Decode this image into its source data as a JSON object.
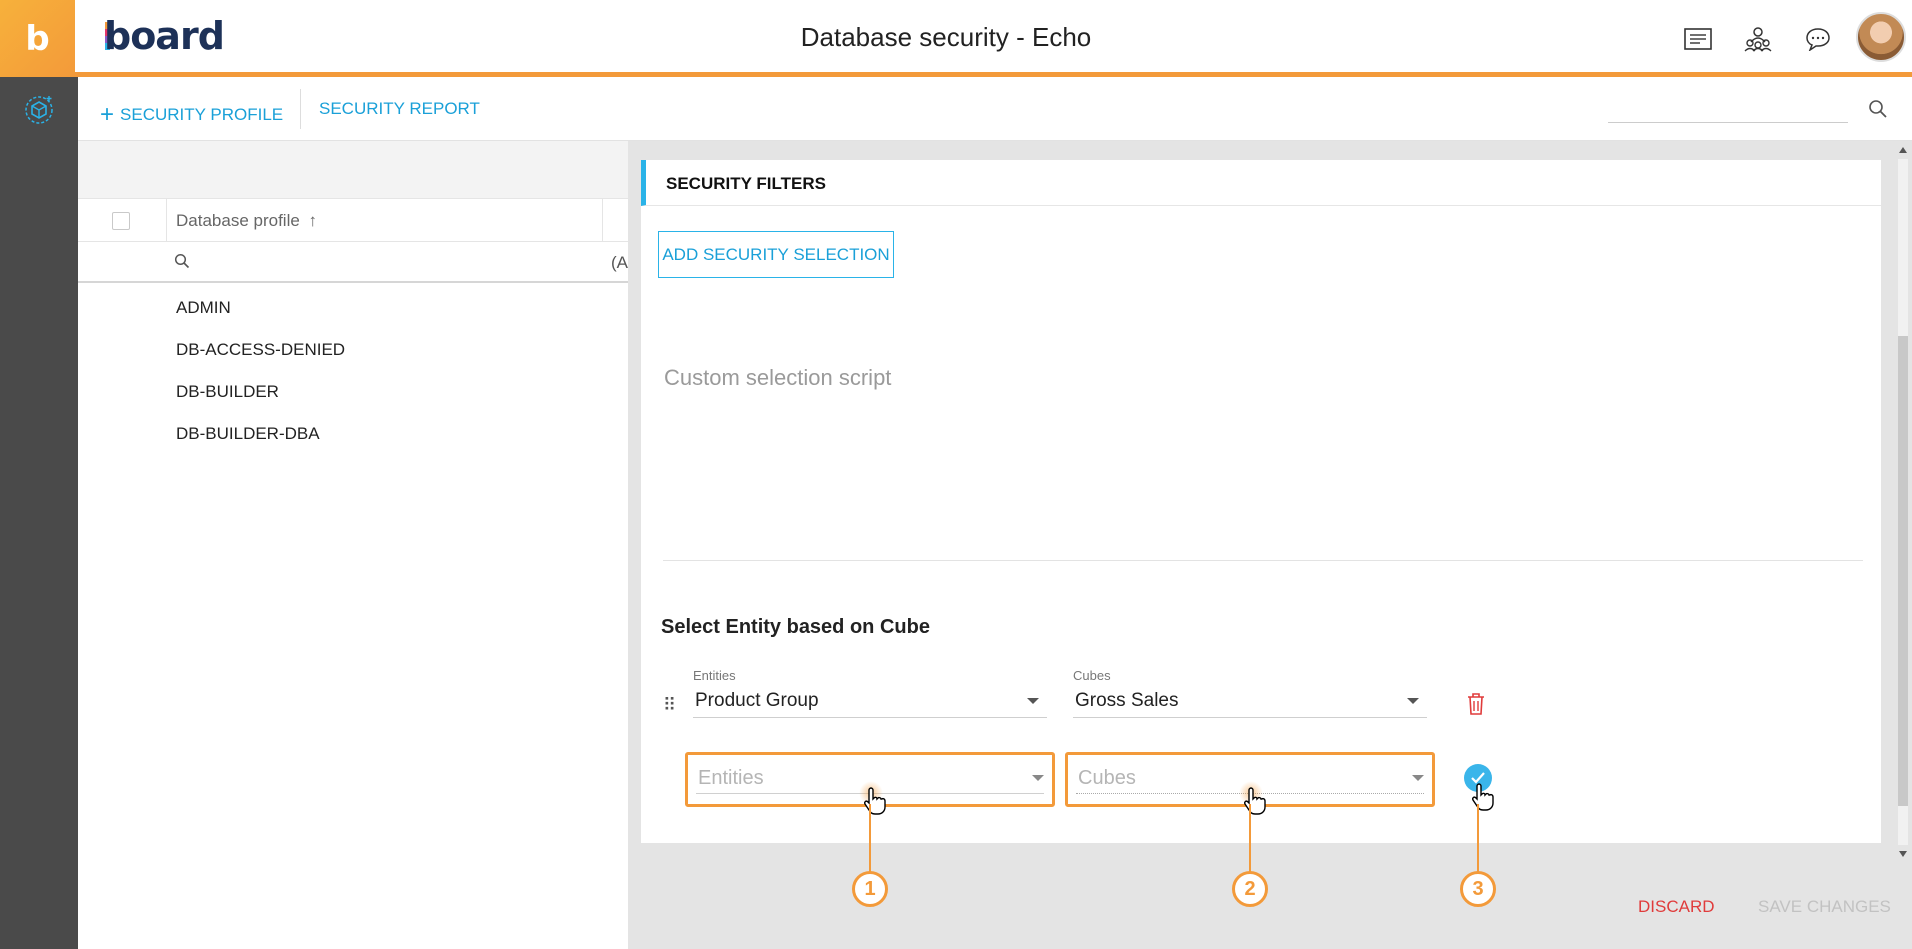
{
  "app": {
    "logo_letter": "b",
    "brand": "board",
    "title": "Database security - Echo"
  },
  "header_icons": [
    "presentation-icon",
    "collaboration-icon",
    "chat-icon",
    "user-avatar"
  ],
  "toolbar": {
    "add_profile_label": "SECURITY PROFILE",
    "report_label": "SECURITY REPORT",
    "search_placeholder": ""
  },
  "grid": {
    "column_header": "Database profile",
    "sort_indicator": "↑",
    "filter_fragment": "(A",
    "rows": [
      "ADMIN",
      "DB-ACCESS-DENIED",
      "DB-BUILDER",
      "DB-BUILDER-DBA"
    ]
  },
  "panel": {
    "section_title": "SECURITY FILTERS",
    "add_selection_label": "ADD SECURITY SELECTION",
    "script_placeholder": "Custom selection script",
    "subsection_title": "Select Entity based on Cube",
    "entities_label": "Entities",
    "cubes_label": "Cubes",
    "entity_value": "Product Group",
    "cube_value": "Gross Sales",
    "new_entity_placeholder": "Entities",
    "new_cube_placeholder": "Cubes"
  },
  "callouts": [
    "1",
    "2",
    "3"
  ],
  "footer": {
    "discard_label": "DISCARD",
    "save_label": "SAVE CHANGES"
  },
  "colors": {
    "accent_orange": "#f39a3a",
    "accent_blue": "#1aa0d8",
    "danger_red": "#e03b3b",
    "rail_gray": "#4a4a4a"
  }
}
